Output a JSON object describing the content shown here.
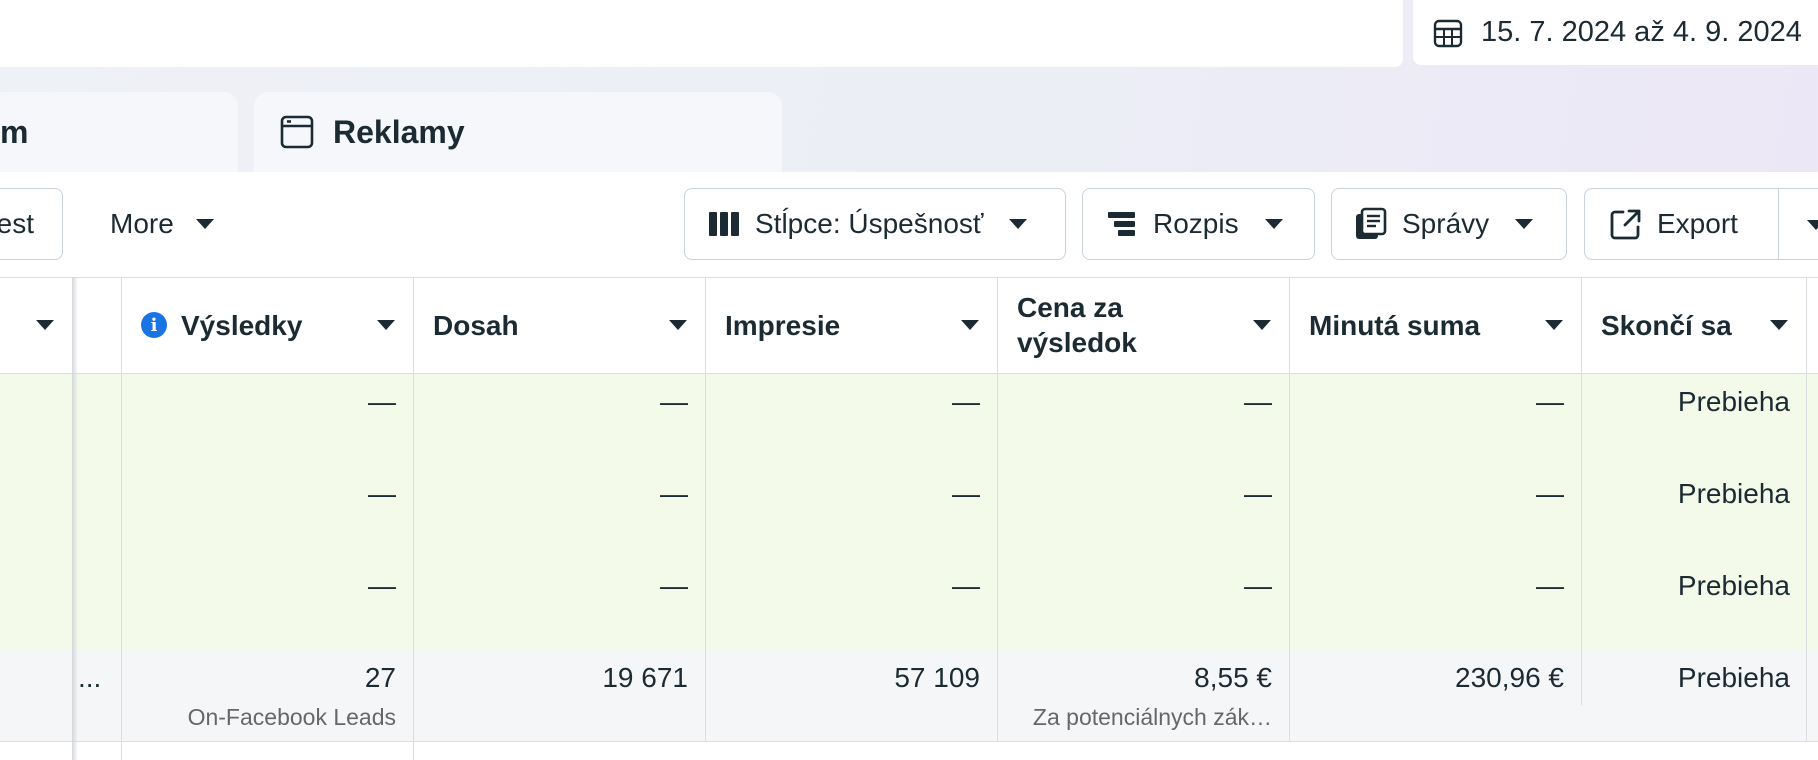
{
  "date_range": "15. 7. 2024 až 4. 9. 2024",
  "tabs": {
    "left_partial": "m",
    "ads": "Reklamy"
  },
  "toolbar": {
    "test_partial": "est",
    "more": "More",
    "columns": "Stĺpce: Úspešnosť",
    "breakdown": "Rozpis",
    "reports": "Správy",
    "export": "Export"
  },
  "table": {
    "headers": {
      "results": "Výsledky",
      "reach": "Dosah",
      "impressions": "Impresie",
      "cost_line1": "Cena za",
      "cost_line2": "výsledok",
      "spent": "Minutá suma",
      "ends": "Skončí sa"
    },
    "dash": "—",
    "rows": [
      {
        "results": "—",
        "reach": "—",
        "impressions": "—",
        "cost": "—",
        "spent": "—",
        "ends": "Prebieha"
      },
      {
        "results": "—",
        "reach": "—",
        "impressions": "—",
        "cost": "—",
        "spent": "—",
        "ends": "Prebieha"
      },
      {
        "results": "—",
        "reach": "—",
        "impressions": "—",
        "cost": "—",
        "spent": "—",
        "ends": "Prebieha"
      }
    ],
    "total": {
      "ellipsis": "...",
      "results": "27",
      "results_sub": "On-Facebook Leads",
      "reach": "19 671",
      "impressions": "57 109",
      "cost": "8,55 €",
      "cost_sub": "Za potenciálnych zák…",
      "spent": "230,96 €",
      "ends": "Prebieha"
    }
  },
  "colors": {
    "accent": "#1b74e4",
    "row_highlight": "#f3fae9",
    "text": "#1c2b33"
  }
}
